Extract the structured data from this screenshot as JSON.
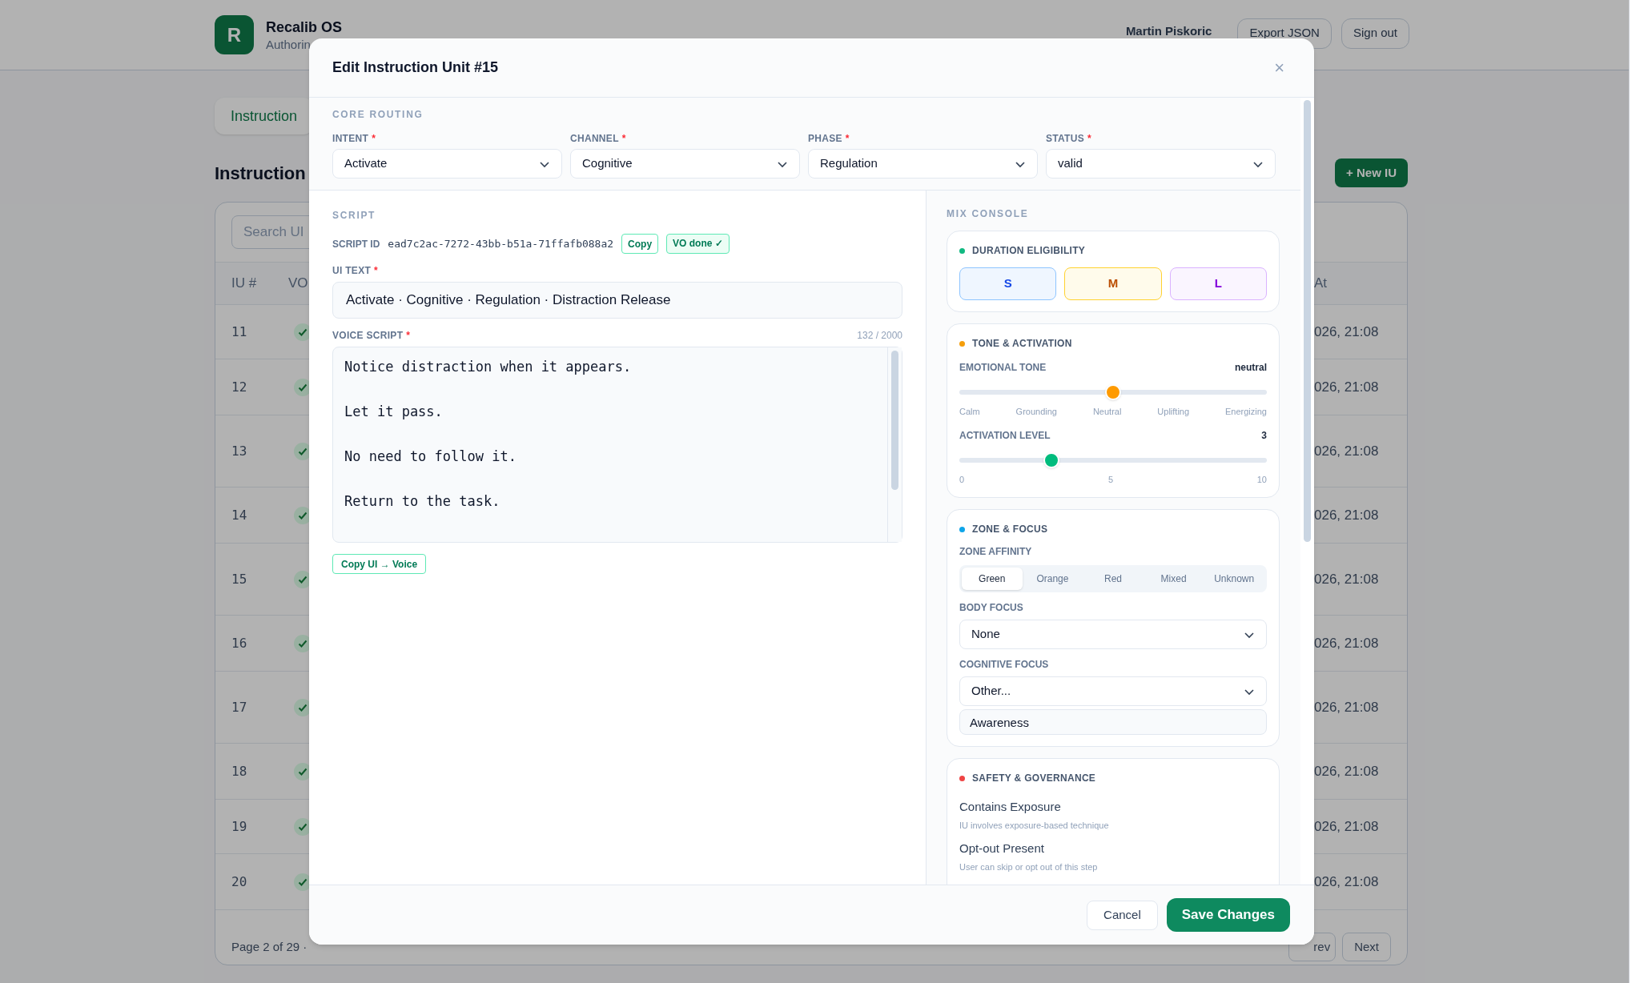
{
  "app": {
    "logo_letter": "R",
    "name": "Recalib OS",
    "subtitle": "Authorin",
    "user": "Martin Piskoric",
    "actions": [
      "Export JSON",
      "Sign out"
    ]
  },
  "page": {
    "tab": "Instruction",
    "heading": "Instruction",
    "new_button": "+ New IU",
    "search": {
      "placeholder": "Search UI"
    },
    "columns": [
      "IU #",
      "VO",
      "At"
    ],
    "rows": [
      {
        "iu": "11",
        "vo_done": true,
        "updated": "026, 21:08"
      },
      {
        "iu": "12",
        "vo_done": true,
        "updated": "026, 21:08"
      },
      {
        "iu": "13",
        "vo_done": true,
        "updated": "026, 21:08"
      },
      {
        "iu": "14",
        "vo_done": true,
        "updated": "026, 21:08"
      },
      {
        "iu": "15",
        "vo_done": true,
        "updated": "026, 21:08"
      },
      {
        "iu": "16",
        "vo_done": true,
        "updated": "026, 21:08"
      },
      {
        "iu": "17",
        "vo_done": true,
        "updated": "026, 21:08"
      },
      {
        "iu": "18",
        "vo_done": true,
        "updated": "026, 21:08"
      },
      {
        "iu": "19",
        "vo_done": true,
        "updated": "026, 21:08"
      },
      {
        "iu": "20",
        "vo_done": true,
        "updated": "026, 21:08"
      }
    ],
    "footer": "Page 2 of 29 ·",
    "pager": [
      "rev",
      "Next"
    ]
  },
  "dialog": {
    "title": "Edit Instruction Unit #15",
    "close": "×",
    "core_routing": {
      "heading": "CORE ROUTING",
      "fields": [
        {
          "label": "INTENT",
          "marker": "*",
          "value": "Activate"
        },
        {
          "label": "CHANNEL",
          "marker": "*",
          "value": "Cognitive"
        },
        {
          "label": "PHASE",
          "marker": "*",
          "value": "Regulation"
        },
        {
          "label": "STATUS",
          "marker": "*",
          "value": "valid"
        }
      ]
    },
    "script": {
      "heading": "SCRIPT",
      "id_label": "SCRIPT ID",
      "id": "ead7c2ac-7272-43bb-b51a-71ffafb088a2",
      "copy": "Copy",
      "vo_badge": "VO done ✓",
      "ui_text": {
        "label": "UI TEXT",
        "marker": "*",
        "value": "Activate · Cognitive · Regulation · Distraction Release"
      },
      "voice": {
        "label": "VOICE SCRIPT",
        "marker": "*",
        "count": "132 / 2000",
        "value": "Notice distraction when it appears.\n\nLet it pass.\n\nNo need to follow it.\n\nReturn to the task."
      },
      "copy_ui_to_voice": "Copy UI → Voice"
    },
    "mix": {
      "heading": "MIX CONSOLE",
      "duration": {
        "title": "DURATION ELIGIBILITY",
        "color": "#10b981",
        "options": [
          {
            "label": "S",
            "selected": true
          },
          {
            "label": "M",
            "selected": true
          },
          {
            "label": "L",
            "selected": true
          }
        ]
      },
      "tone": {
        "title": "TONE & ACTIVATION",
        "color": "#f59e0b",
        "emotional": {
          "label": "EMOTIONAL TONE",
          "reading": "neutral",
          "level": 0.5,
          "ticks": [
            "Calm",
            "Grounding",
            "Neutral",
            "Uplifting",
            "Energizing"
          ]
        },
        "activation": {
          "label": "ACTIVATION LEVEL",
          "reading": "3",
          "level": 0.3,
          "ticks": [
            "0",
            "5",
            "10"
          ]
        }
      },
      "zone": {
        "title": "ZONE & FOCUS",
        "color": "#0ea5e9",
        "affinity_label": "ZONE AFFINITY",
        "affinity": [
          {
            "label": "Green",
            "selected": true
          },
          {
            "label": "Orange",
            "selected": false
          },
          {
            "label": "Red",
            "selected": false
          },
          {
            "label": "Mixed",
            "selected": false
          },
          {
            "label": "Unknown",
            "selected": false
          }
        ],
        "body_focus": {
          "label": "BODY FOCUS",
          "value": "None"
        },
        "cognitive_focus": {
          "label": "COGNITIVE FOCUS",
          "value": "Other...",
          "other": "Awareness"
        }
      },
      "safety": {
        "title": "SAFETY & GOVERNANCE",
        "color": "#ef4444",
        "items": [
          {
            "name": "Contains Exposure",
            "description": "IU involves exposure-based technique"
          },
          {
            "name": "Opt-out Present",
            "description": "User can skip or opt out of this step"
          }
        ]
      }
    },
    "footer": {
      "cancel": "Cancel",
      "save": "Save Changes"
    }
  }
}
